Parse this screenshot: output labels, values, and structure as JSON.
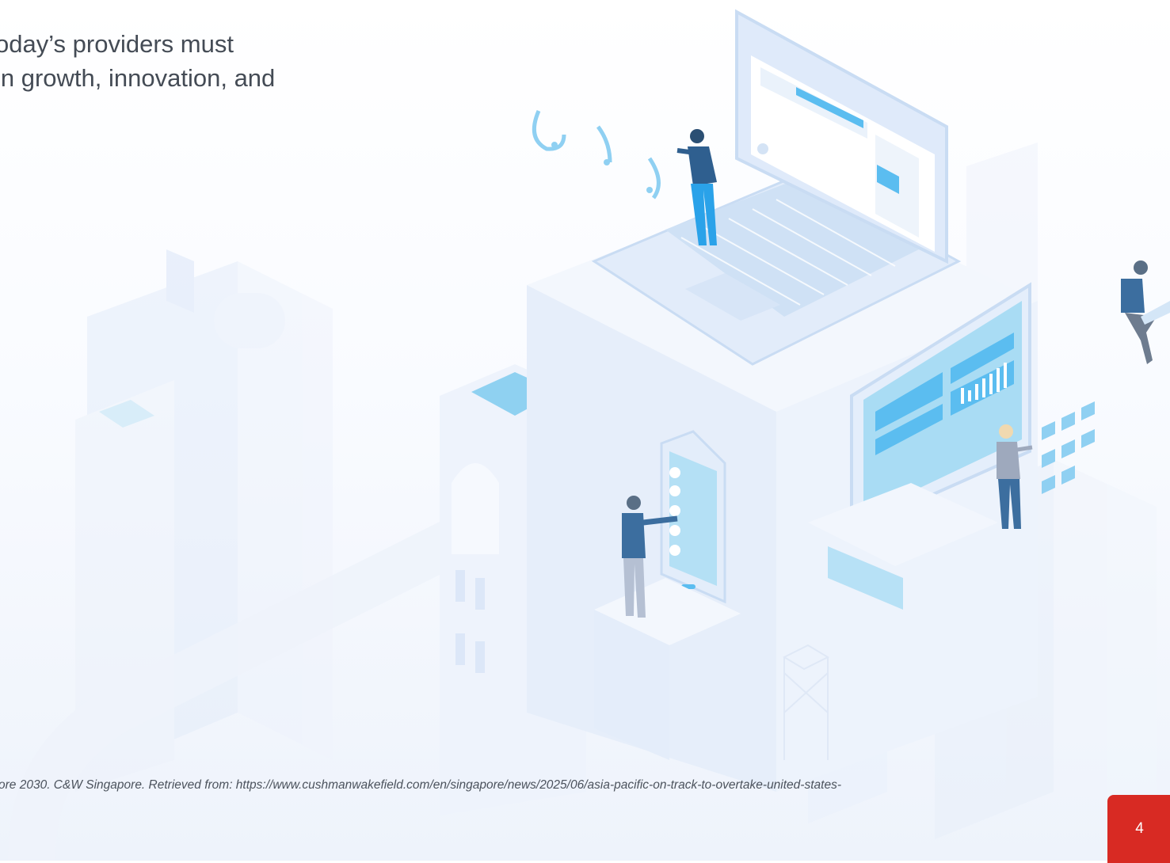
{
  "slide": {
    "intro_lines": [
      "oday’s providers must",
      "in growth, innovation, and"
    ],
    "footnote": "ore 2030. C&W Singapore. Retrieved from: https://www.cushmanwakefield.com/en/singapore/news/2025/06/asia-pacific-on-track-to-overtake-united-states-",
    "page_number": "4"
  },
  "colors": {
    "accent": "#d82a23",
    "body_text": "#444b55",
    "illustration_blue": "#4fb6ec",
    "illustration_pale": "#dbe8f8"
  },
  "icons": [
    "isometric-city-illustration",
    "laptop-icon",
    "smartphone-icon",
    "dashboard-screen-icon",
    "wifi-signal-icon",
    "person-figure"
  ]
}
